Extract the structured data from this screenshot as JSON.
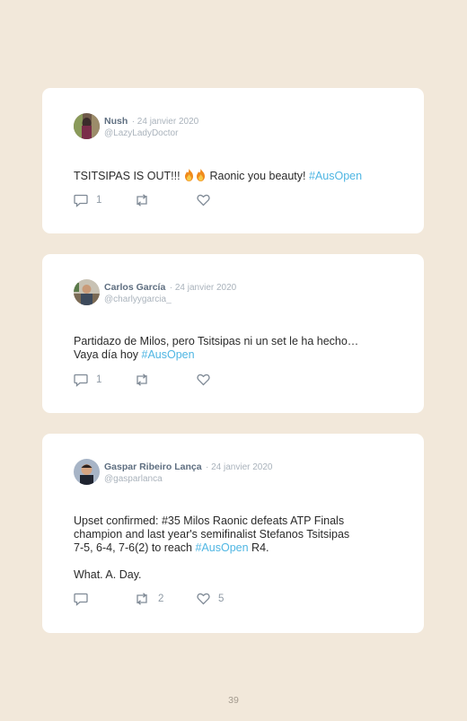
{
  "tweets": [
    {
      "name": "Nush",
      "date": "· 24 janvier 2020",
      "handle": "@LazyLadyDoctor",
      "text_before": "TSITSIPAS IS OUT!!! ",
      "emoji_icons": [
        "fire-icon",
        "fire-icon"
      ],
      "text_mid": " Raonic you beauty! ",
      "hashtag": "#AusOpen",
      "text_after": "",
      "replies": "1",
      "retweets": "",
      "likes": ""
    },
    {
      "name": "Carlos García",
      "date": "· 24 janvier 2020",
      "handle": "@charlyygarcia_",
      "text_before": "Partidazo de Milos, pero Tsitsipas ni un set le ha hecho…\nVaya día hoy ",
      "hashtag": "#AusOpen",
      "text_after": "",
      "replies": "1",
      "retweets": "",
      "likes": ""
    },
    {
      "name": "Gaspar Ribeiro Lança",
      "date": "· 24 janvier 2020",
      "handle": "@gasparlanca",
      "text_before": "Upset confirmed: #35 Milos Raonic defeats ATP Finals\nchampion and last year's semifinalist Stefanos Tsitsipas\n7-5, 6-4, 7-6(2) to reach ",
      "hashtag": "#AusOpen",
      "text_after": " R4.\n\nWhat. A. Day.",
      "replies": "",
      "retweets": "2",
      "likes": "5"
    }
  ],
  "page_number": "39",
  "colors": {
    "background": "#f2e8da",
    "card": "#ffffff",
    "hashtag": "#4fb6e3",
    "name": "#5e6e80",
    "muted": "#aab3bc"
  }
}
